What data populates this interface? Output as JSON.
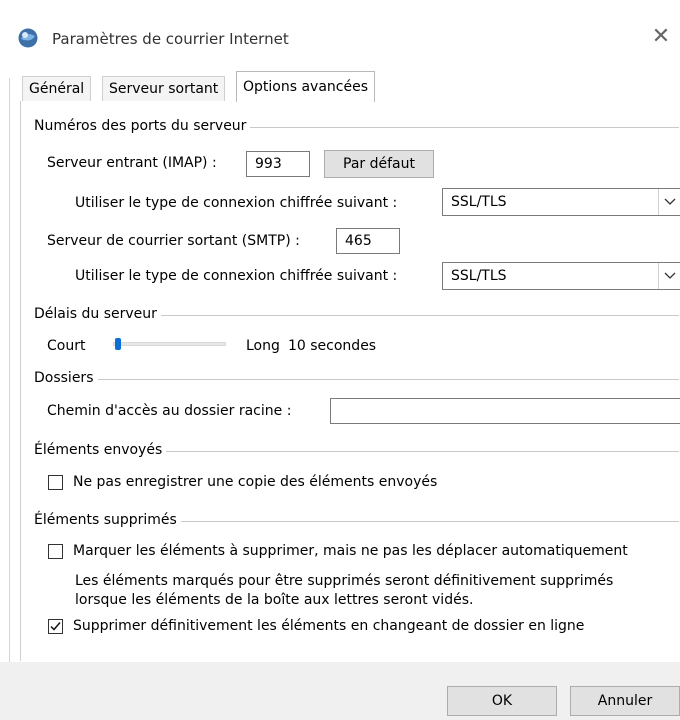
{
  "window": {
    "title": "Paramètres de courrier Internet",
    "close_glyph": "✕",
    "icon": "outlook-mail-icon"
  },
  "tabs": [
    {
      "label": "Général",
      "active": false
    },
    {
      "label": "Serveur sortant",
      "active": false
    },
    {
      "label": "Options avancées",
      "active": true
    }
  ],
  "ports": {
    "group_label": "Numéros des ports du serveur",
    "incoming_label": "Serveur entrant (IMAP) :",
    "incoming_value": "993",
    "default_button": "Par défaut",
    "incoming_enc_label": "Utiliser le type de connexion chiffrée suivant :",
    "incoming_enc_value": "SSL/TLS",
    "outgoing_label": "Serveur de courrier sortant (SMTP) :",
    "outgoing_value": "465",
    "outgoing_enc_label": "Utiliser le type de connexion chiffrée suivant :",
    "outgoing_enc_value": "SSL/TLS"
  },
  "timeouts": {
    "group_label": "Délais du serveur",
    "short_label": "Court",
    "long_label": "Long",
    "value_text": "10 secondes",
    "slider_fraction": 0.02
  },
  "folders": {
    "group_label": "Dossiers",
    "root_path_label": "Chemin d'accès au dossier racine :",
    "root_path_value": ""
  },
  "sent_items": {
    "group_label": "Éléments envoyés",
    "no_copy_label": "Ne pas enregistrer une copie des éléments envoyés",
    "no_copy_checked": false
  },
  "deleted_items": {
    "group_label": "Éléments supprimés",
    "mark_label": "Marquer les éléments à supprimer, mais ne pas les déplacer automatiquement",
    "mark_checked": false,
    "note_line1": "Les éléments marqués pour être supprimés seront définitivement supprimés",
    "note_line2": "lorsque les éléments de la boîte aux lettres seront vidés.",
    "purge_label": "Supprimer définitivement les éléments en changeant de dossier en ligne",
    "purge_checked": true
  },
  "footer": {
    "ok_label": "OK",
    "cancel_label": "Annuler"
  },
  "colors": {
    "slider_thumb": "#0b6fd6",
    "footer_bg": "#f0f0f0"
  }
}
